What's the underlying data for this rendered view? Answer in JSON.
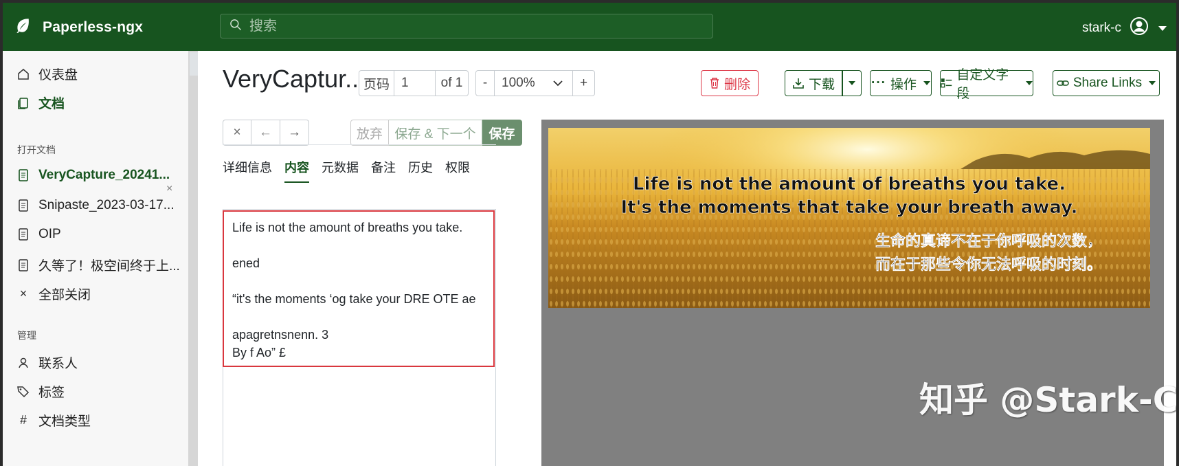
{
  "app": {
    "name": "Paperless-ngx"
  },
  "search": {
    "placeholder": "搜索"
  },
  "user": {
    "name": "stark-c"
  },
  "sidebar": {
    "dashboard": "仪表盘",
    "documents": "文档",
    "open_docs_label": "打开文档",
    "open_docs": [
      "VeryCapture_20241...",
      "Snipaste_2023-03-17...",
      "OIP",
      "久等了！极空间终于上..."
    ],
    "close_all": "全部关闭",
    "manage_label": "管理",
    "correspondents": "联系人",
    "tags": "标签",
    "doc_types": "文档类型"
  },
  "document": {
    "title": "VeryCaptur...",
    "page_label": "页码",
    "page_value": "1",
    "page_of": "of 1",
    "zoom_minus": "-",
    "zoom_value": "100%",
    "zoom_plus": "+",
    "delete_label": "删除",
    "download_label": "下载",
    "actions_label": "操作",
    "custom_fields_label": "自定义字段",
    "share_links_label": "Share Links",
    "close_btn": "×",
    "prev_btn": "←",
    "next_btn": "→",
    "discard_label": "放弃",
    "save_next_label": "保存 & 下一个",
    "save_label": "保存"
  },
  "tabs": [
    "详细信息",
    "内容",
    "元数据",
    "备注",
    "历史",
    "权限"
  ],
  "active_tab": "内容",
  "content_text": "Life is not the amount of breaths you take.\n\nened\n\n“it's the moments ‘og take your DRE OTE ae\n\napagretnsnenn. 3\nBy f Ao” £",
  "preview": {
    "line1": "Life is not the amount of breaths you take.",
    "line2": "It's the moments that take your breath away.",
    "line3": "生命的真谛不在于你呼吸的次数，",
    "line4": "而在于那些令你无法呼吸的时刻。",
    "watermark": "知乎 @Stark-C"
  },
  "colors": {
    "brand": "#17541f",
    "danger": "#dc3545",
    "highlight": "#d9373e"
  }
}
